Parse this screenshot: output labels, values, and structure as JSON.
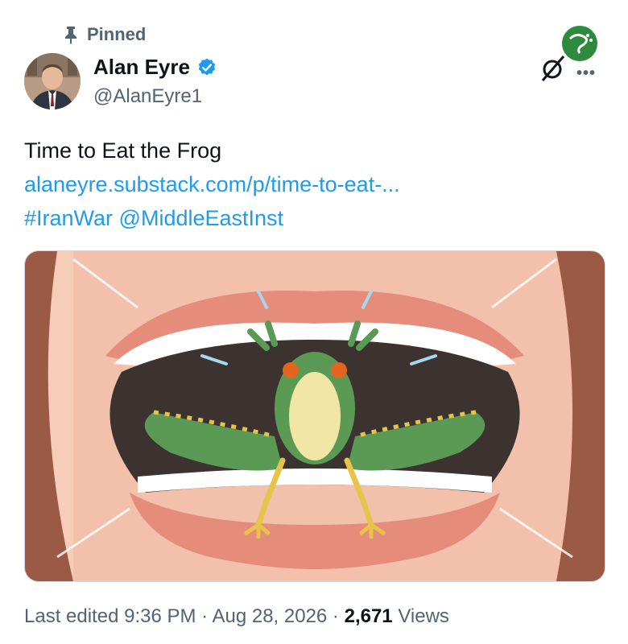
{
  "pinned_label": "Pinned",
  "author": {
    "display_name": "Alan Eyre",
    "handle": "@AlanEyre1",
    "verified": true,
    "verified_color": "#1d9bf0"
  },
  "tweet": {
    "text": "Time to Eat the Frog",
    "link_text": "alaneyre.substack.com/p/time-to-eat-...",
    "hashtag": "#IranWar",
    "mention": "@MiddleEastInst",
    "link_color": "#1d9bf0"
  },
  "media": {
    "illustration": "frog-in-mouth-illustration"
  },
  "meta": {
    "edited": "Last edited 9:36 PM · Aug 28, 2026 · ",
    "views_count": "2,671",
    "views_label": " Views"
  },
  "icons": {
    "pin": "pin-icon",
    "verified": "verified-badge-icon",
    "more": "more-options-icon",
    "watermark": "channel-logo-watermark"
  }
}
